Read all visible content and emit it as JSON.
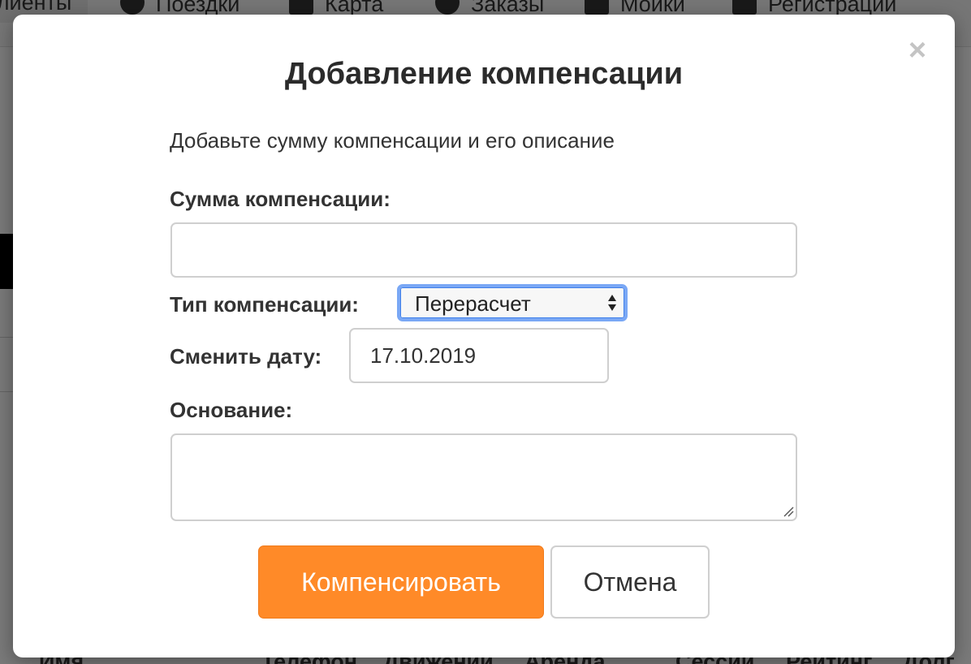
{
  "background": {
    "nav_items": [
      {
        "label": "Клиенты",
        "icon": "users-icon",
        "active": true
      },
      {
        "label": "Поездки",
        "icon": "clock-icon",
        "active": false
      },
      {
        "label": "Карта",
        "icon": "map-icon",
        "active": false
      },
      {
        "label": "Заказы",
        "icon": "map-pin-icon",
        "active": false
      },
      {
        "label": "Мойки",
        "icon": "shower-icon",
        "active": false
      },
      {
        "label": "Регистрации",
        "icon": "id-card-icon",
        "active": false
      }
    ],
    "table_headers": [
      "Имя",
      "Телефон",
      "Движений",
      "Аренда",
      "Сессий",
      "Рейтинг",
      "Долг"
    ]
  },
  "modal": {
    "title": "Добавление компенсации",
    "description": "Добавьте сумму компенсации и его описание",
    "close_symbol": "×",
    "amount": {
      "label": "Сумма компенсации:",
      "value": ""
    },
    "type": {
      "label": "Тип компенсации:",
      "selected": "Перерасчет"
    },
    "date": {
      "label": "Сменить дату:",
      "value": "17.10.2019"
    },
    "reason": {
      "label": "Основание:",
      "value": ""
    },
    "buttons": {
      "submit": "Компенсировать",
      "cancel": "Отмена"
    }
  },
  "colors": {
    "primary_button": "#ff8a28",
    "focus_ring": "#7aa8f5"
  }
}
